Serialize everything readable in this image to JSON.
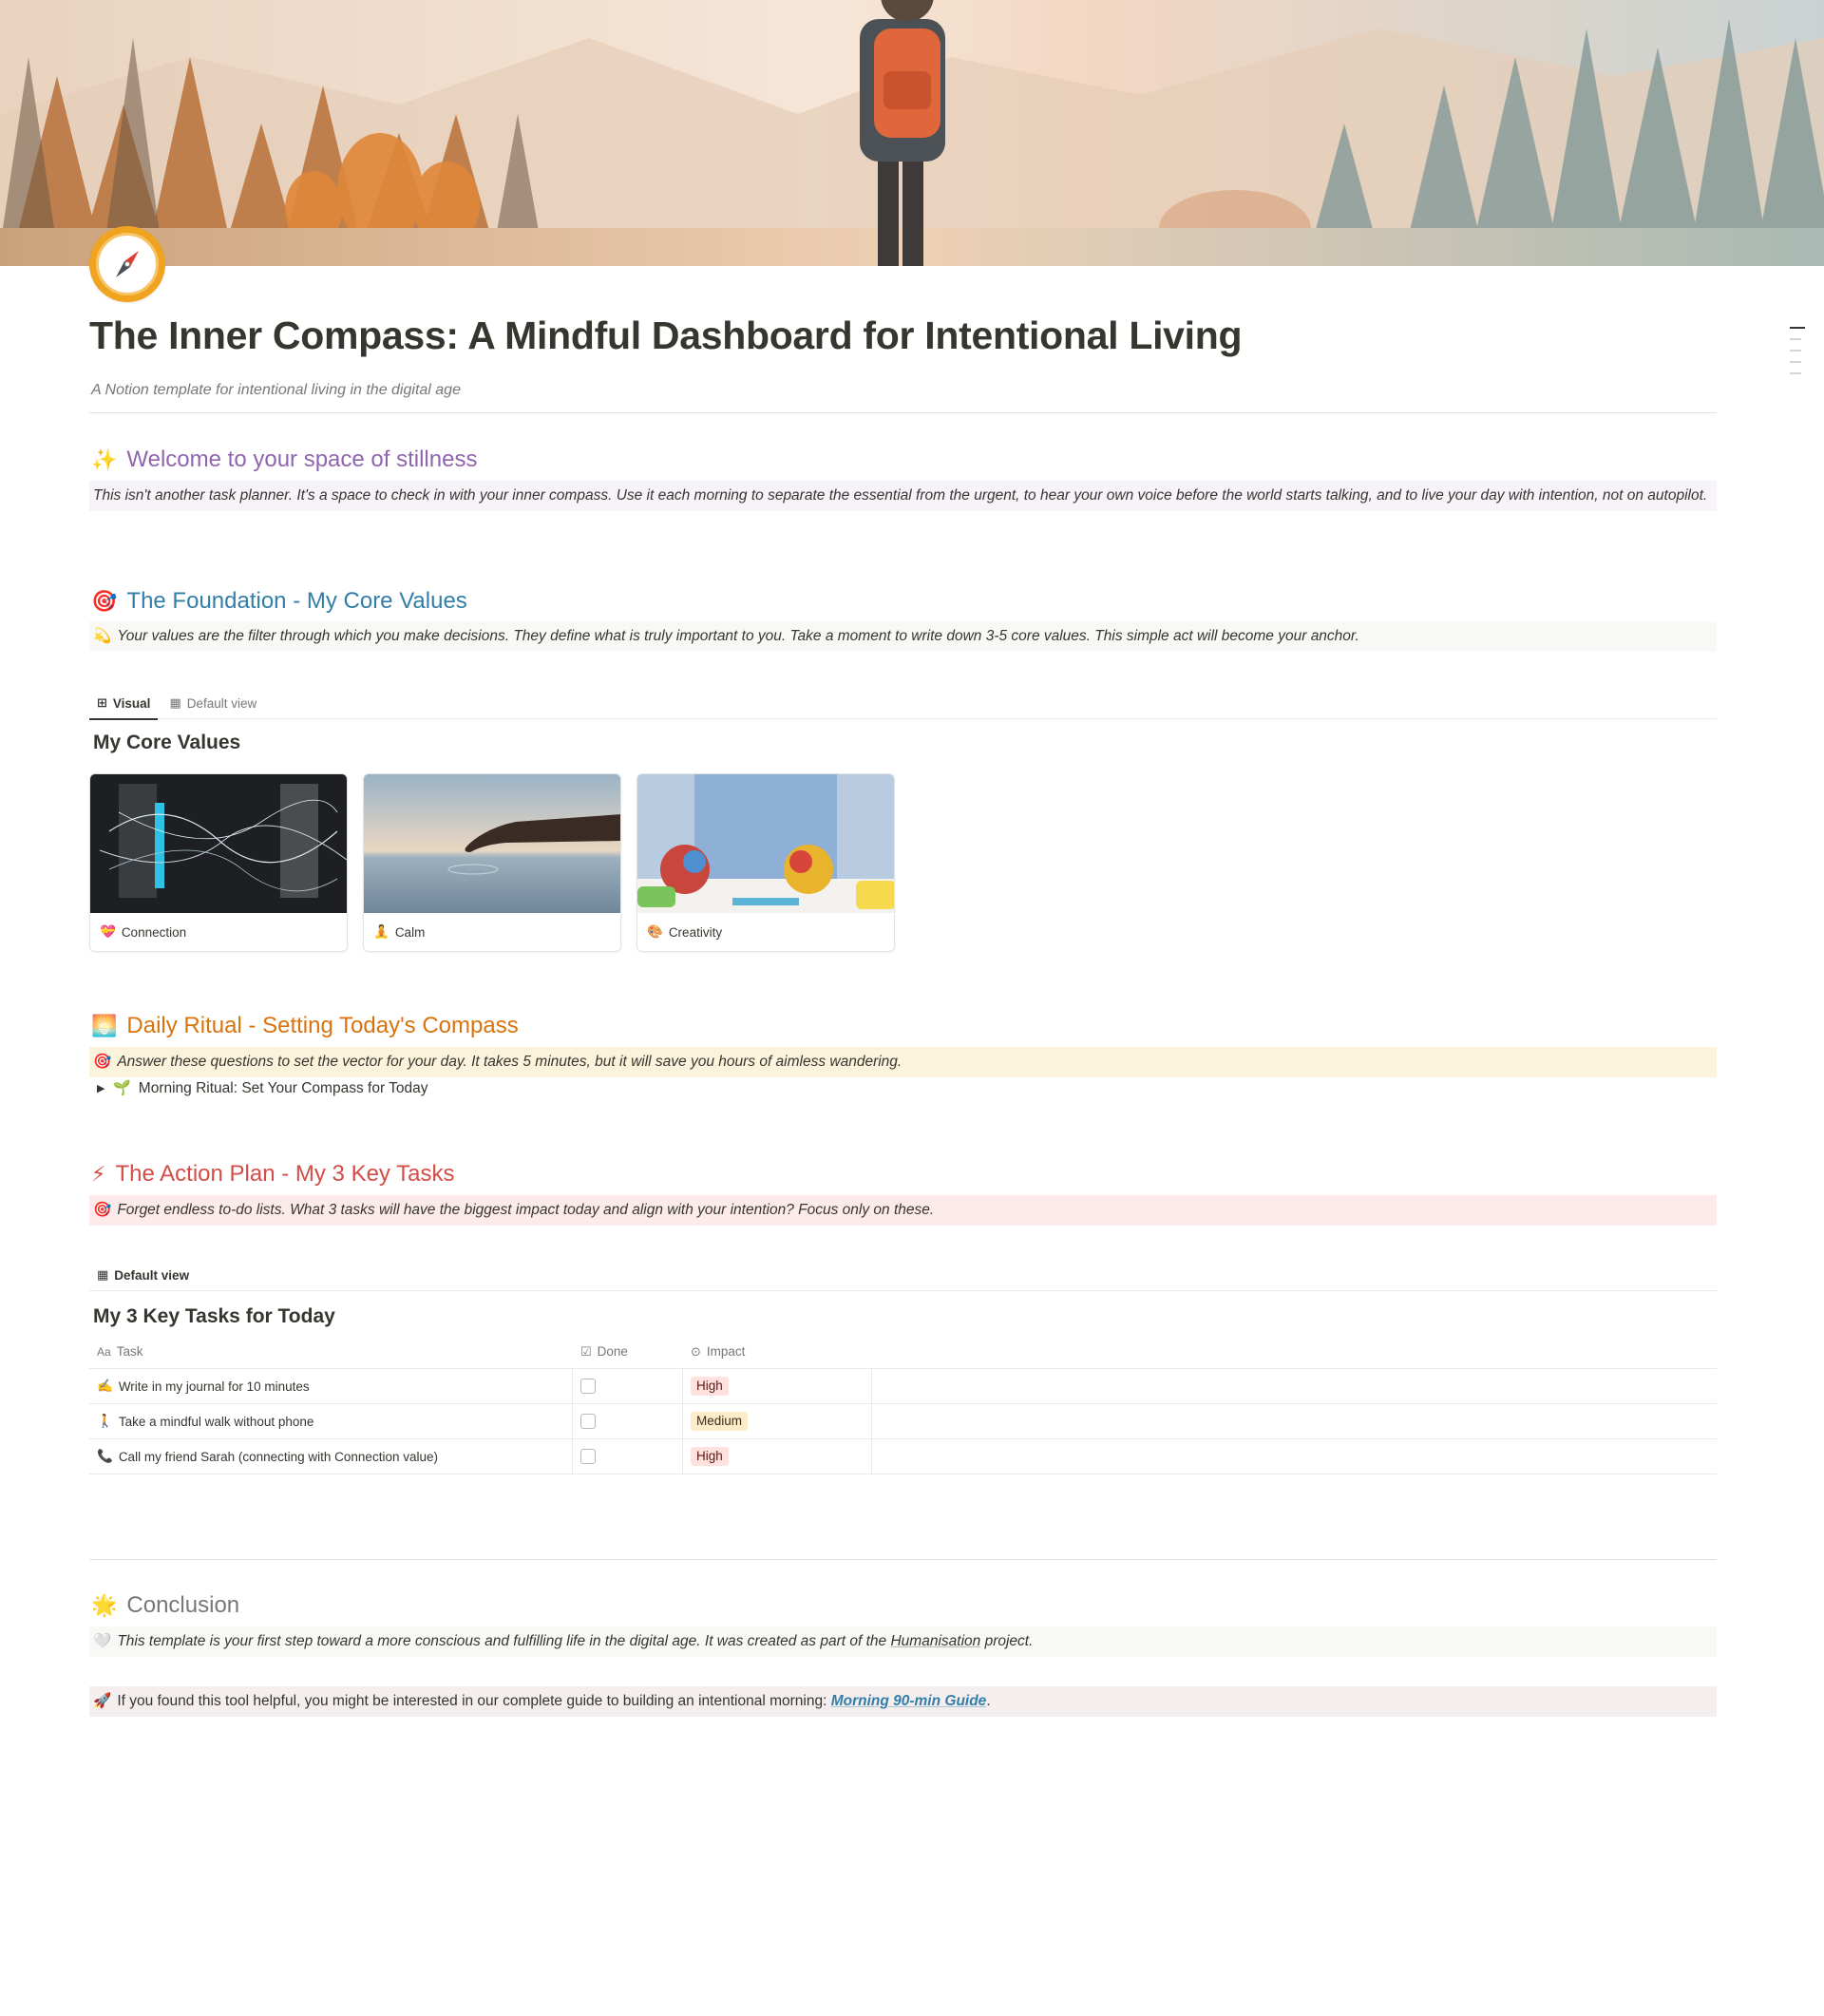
{
  "page": {
    "title": "The Inner Compass: A Mindful Dashboard for Intentional Living",
    "subtitle": "A Notion template for intentional living in the digital age",
    "icon": "compass-icon"
  },
  "welcome": {
    "emoji": "✨",
    "heading": "Welcome to your space of stillness",
    "body": "This isn't another task planner. It's a space to check in with your inner compass. Use it each morning to separate the essential from the urgent, to hear your own voice before the world starts talking, and to live your day with intention, not on autopilot."
  },
  "foundation": {
    "emoji": "🎯",
    "heading": "The Foundation - My Core Values",
    "callout_icon": "💫",
    "callout": "Your values are the filter through which you make decisions. They define what is truly important to you. Take a moment to write down 3-5 core values. This simple act will become your anchor.",
    "tabs": [
      {
        "icon": "⊞",
        "label": "Visual"
      },
      {
        "icon": "▦",
        "label": "Default view"
      }
    ],
    "db_title": "My Core Values",
    "cards": [
      {
        "emoji": "💝",
        "label": "Connection"
      },
      {
        "emoji": "🧘",
        "label": "Calm"
      },
      {
        "emoji": "🎨",
        "label": "Creativity"
      }
    ]
  },
  "ritual": {
    "emoji": "🌅",
    "heading": "Daily Ritual - Setting Today's Compass",
    "callout_icon": "🎯",
    "callout": "Answer these questions to set the vector for your day. It takes 5 minutes, but it will save you hours of aimless wandering.",
    "toggle_icon": "🌱",
    "toggle": "Morning Ritual: Set Your Compass for Today"
  },
  "action": {
    "emoji": "⚡",
    "heading": "The Action Plan - My 3 Key Tasks",
    "callout_icon": "🎯",
    "callout": "Forget endless to-do lists. What 3 tasks will have the biggest impact today and align with your intention? Focus only on these.",
    "tab_label": "Default view",
    "db_title": "My 3 Key Tasks for Today",
    "columns": {
      "task": "Task",
      "done": "Done",
      "impact": "Impact"
    },
    "rows": [
      {
        "emoji": "✍️",
        "task": "Write in my journal for 10 minutes",
        "done": false,
        "impact": "High"
      },
      {
        "emoji": "🚶",
        "task": "Take a mindful walk without phone",
        "done": false,
        "impact": "Medium"
      },
      {
        "emoji": "📞",
        "task": "Call my friend Sarah (connecting with Connection value)",
        "done": false,
        "impact": "High"
      }
    ]
  },
  "conclusion": {
    "emoji": "🌟",
    "heading": "Conclusion",
    "callout_icon": "🤍",
    "callout_pre": "This template is your first step toward a more conscious and fulfilling life in the digital age. It was created as part of the",
    "callout_link": "Humanisation",
    "callout_post": "project.",
    "guide_icon": "🚀",
    "guide_pre": "If you found this tool helpful, you might be interested in our complete guide to building an intentional morning:",
    "guide_link": "Morning 90-min Guide",
    "guide_post": "."
  },
  "colors": {
    "purple": "#9065b0",
    "blue": "#337ea9",
    "orange": "#d9730d",
    "red": "#d44c47",
    "gray": "#787774"
  }
}
